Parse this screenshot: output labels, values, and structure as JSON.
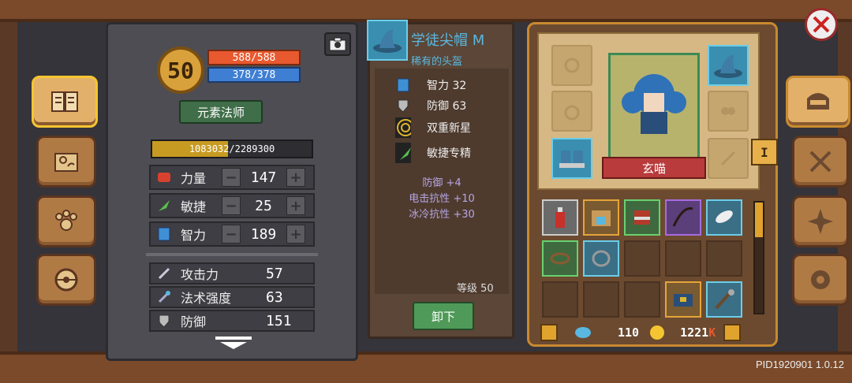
{
  "character": {
    "level": "50",
    "hp": "588/588",
    "mp": "378/378",
    "class_name": "元素法师",
    "xp_text": "1083032/2289300",
    "xp_fraction": 0.473,
    "name": "玄喵"
  },
  "attributes": [
    {
      "name": "力量",
      "value": "147",
      "icon": "fist-icon"
    },
    {
      "name": "敏捷",
      "value": "25",
      "icon": "feather-icon"
    },
    {
      "name": "智力",
      "value": "189",
      "icon": "book-icon"
    }
  ],
  "stats": [
    {
      "name": "攻击力",
      "value": "57",
      "icon": "sword-icon"
    },
    {
      "name": "法术强度",
      "value": "63",
      "icon": "wand-icon"
    },
    {
      "name": "防御",
      "value": "151",
      "icon": "shield-icon"
    }
  ],
  "item": {
    "name": "学徒尖帽",
    "tier": "M",
    "rarity": "稀有的头盔",
    "int_line": "智力 32",
    "def_line": "防御 63",
    "skill1": "双重新星",
    "skill2": "敏捷专精",
    "bonus1": "防御 +4",
    "bonus2": "电击抗性 +10",
    "bonus3": "冰冷抗性 +30",
    "level_line": "等级 50",
    "unequip_label": "卸下"
  },
  "currency": {
    "gems": "110",
    "gold": "1221",
    "gold_suffix": "K"
  },
  "tab_marker": "I",
  "version": "PID1920901 1.0.12",
  "colors": {
    "accent_gold": "#e0a32e",
    "rarity_blue": "#5ab7e0",
    "bonus_purple": "#b7a6e6"
  }
}
